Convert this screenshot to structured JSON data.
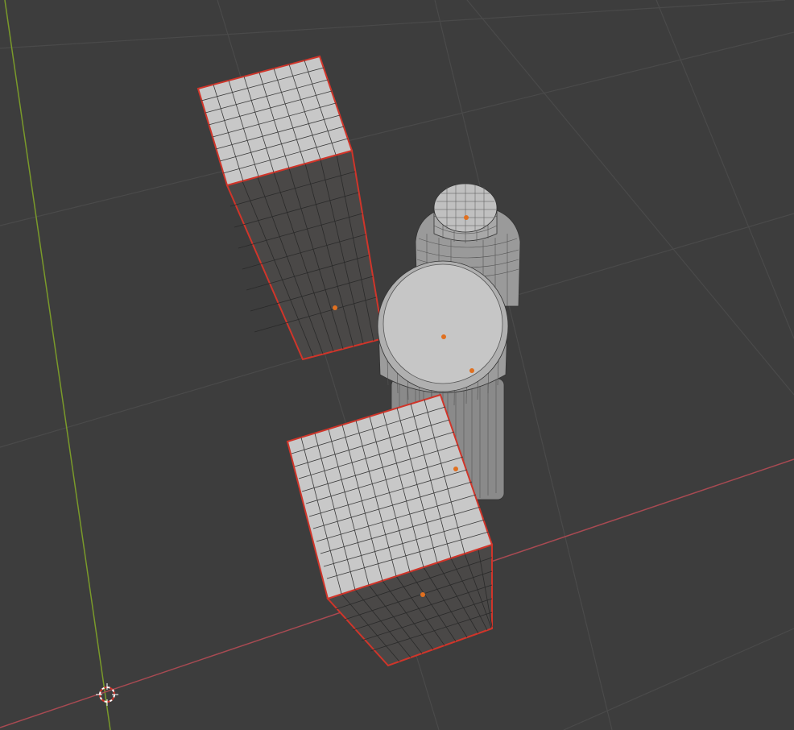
{
  "viewport": {
    "background": "#3d3d3d",
    "grid_color": "#4a4a4a",
    "x_axis_color": "#a84a52",
    "y_axis_color": "#7a9a2a",
    "selection_outline": "#d0352a",
    "origin_dot": "#e07020",
    "face_light": "#c8c8c8",
    "face_dark": "#4a4847"
  },
  "scene": {
    "objects": [
      "tall-box",
      "bottle",
      "short-box"
    ],
    "cursor": "3d-cursor-icon"
  }
}
